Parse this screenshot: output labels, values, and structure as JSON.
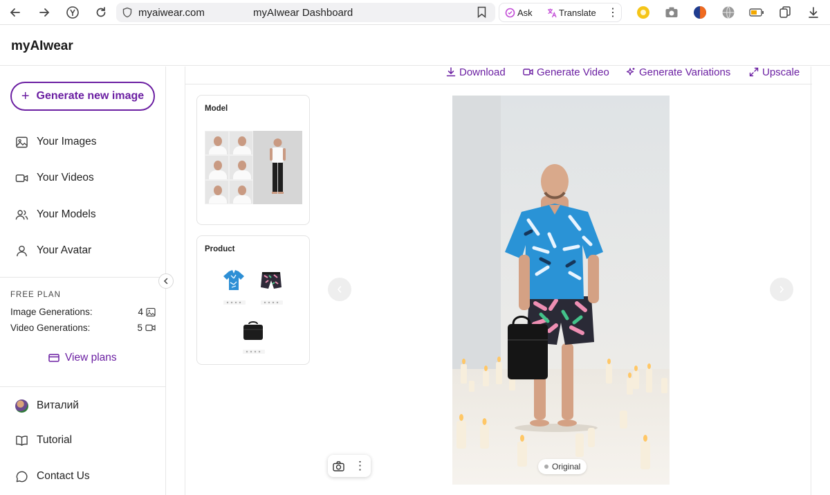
{
  "browser": {
    "url": "myaiwear.com",
    "page_title": "myAIwear Dashboard",
    "ask_label": "Ask",
    "translate_label": "Translate"
  },
  "app": {
    "brand": "myAIwear"
  },
  "sidebar": {
    "generate_label": "Generate new image",
    "items": [
      {
        "label": "Your Images",
        "icon": "image-icon"
      },
      {
        "label": "Your Videos",
        "icon": "video-icon"
      },
      {
        "label": "Your Models",
        "icon": "users-icon"
      },
      {
        "label": "Your Avatar",
        "icon": "user-icon"
      }
    ],
    "plan": {
      "label": "FREE PLAN",
      "image_generations_label": "Image Generations:",
      "image_generations_value": "4",
      "video_generations_label": "Video Generations:",
      "video_generations_value": "5",
      "view_plans_label": "View plans"
    },
    "user_name": "Виталий",
    "tutorial_label": "Tutorial",
    "contact_label": "Contact Us"
  },
  "toolbar": {
    "download_label": "Download",
    "generate_video_label": "Generate Video",
    "generate_variations_label": "Generate Variations",
    "upscale_label": "Upscale"
  },
  "cards": {
    "model_title": "Model",
    "product_title": "Product"
  },
  "viewer": {
    "original_label": "Original"
  },
  "colors": {
    "accent": "#6b1fa2"
  }
}
